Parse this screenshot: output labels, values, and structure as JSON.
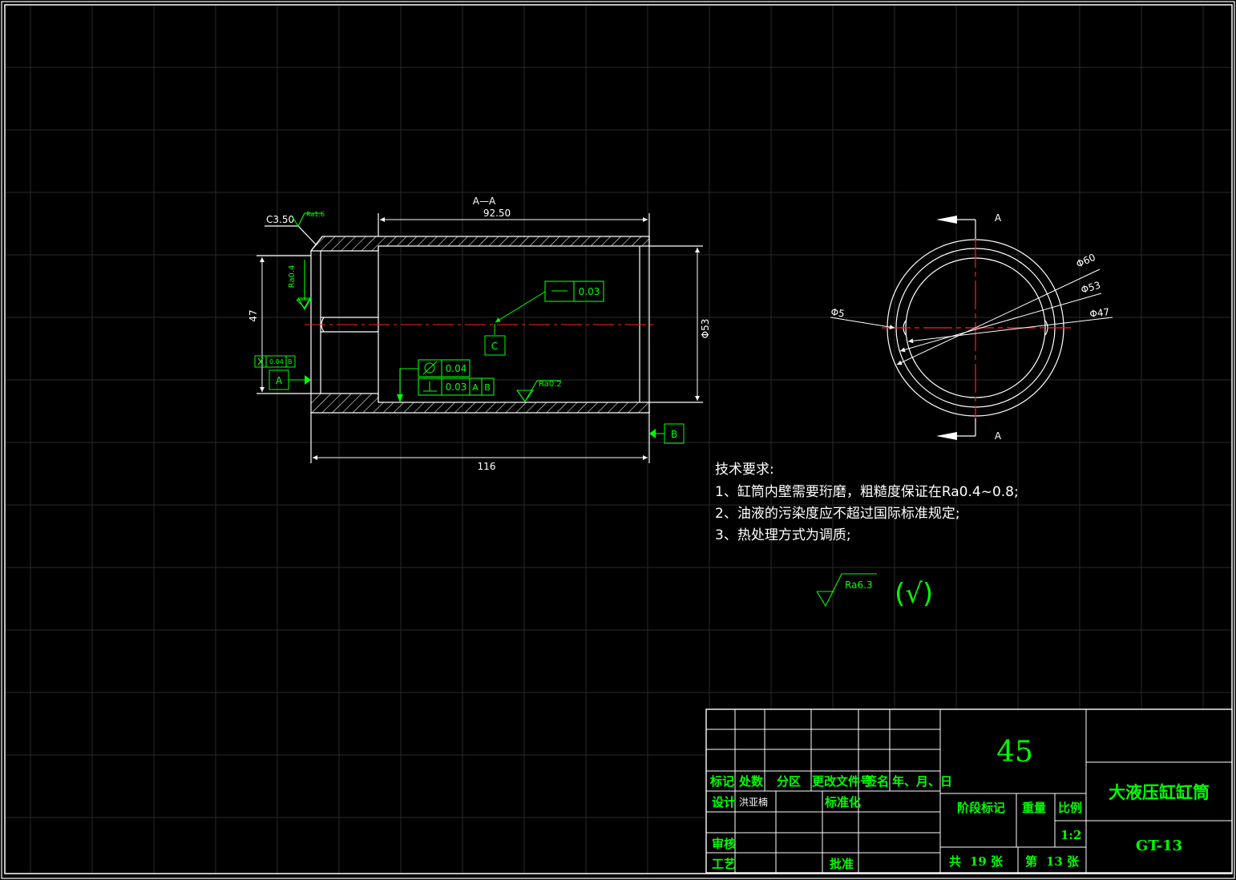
{
  "section_view": {
    "section_label": "A—A",
    "dim_inner_length": "92.50",
    "dim_total_length": "116",
    "dim_bore": "47",
    "dim_outer_dia": "Φ53",
    "chamfer": "C3.50",
    "roughness_chamfer": "Ra1.6",
    "roughness_left": "Ra0.4",
    "roughness_bottom": "Ra0.2",
    "tol_straight": "0.03",
    "tol_circ": "0.04",
    "tol_perp": "0.03",
    "tol_perp_refA": "A",
    "tol_perp_refB": "B",
    "tol_small_value": "0.04",
    "tol_small_ref": "B",
    "datum_a": "A",
    "datum_b": "B",
    "datum_c": "C"
  },
  "end_view": {
    "label_top": "A",
    "label_bottom": "A",
    "dia_outer": "Φ60",
    "dia_mid": "Φ53",
    "dia_inner": "Φ47",
    "dia_hole": "Φ5"
  },
  "tech_requirements": {
    "title": "技术要求:",
    "items": [
      "1、缸筒内壁需要珩磨，粗糙度保证在Ra0.4~0.8;",
      "2、油液的污染度应不超过国际标准规定;",
      "3、热处理方式为调质;"
    ]
  },
  "general_roughness": {
    "value": "Ra6.3",
    "bracket": "(√)"
  },
  "title_block": {
    "material": "45",
    "part_name": "大液压缸缸筒",
    "drawing_no": "GT-13",
    "headers": [
      "标记",
      "处数",
      "分区",
      "更改文件号",
      "签名",
      "年、月、日"
    ],
    "design_label": "设计",
    "designer": "洪亚楠",
    "standardize_label": "标准化",
    "review_label": "审核",
    "process_label": "工艺",
    "approve_label": "批准",
    "stage_label": "阶段标记",
    "weight_label": "重量",
    "scale_label": "比例",
    "scale_value": "1:2",
    "sheets_total_prefix": "共",
    "sheets_total": "19",
    "sheets_unit": "张",
    "sheet_no_prefix": "第",
    "sheet_no": "13",
    "sheet_no_unit": "张"
  }
}
